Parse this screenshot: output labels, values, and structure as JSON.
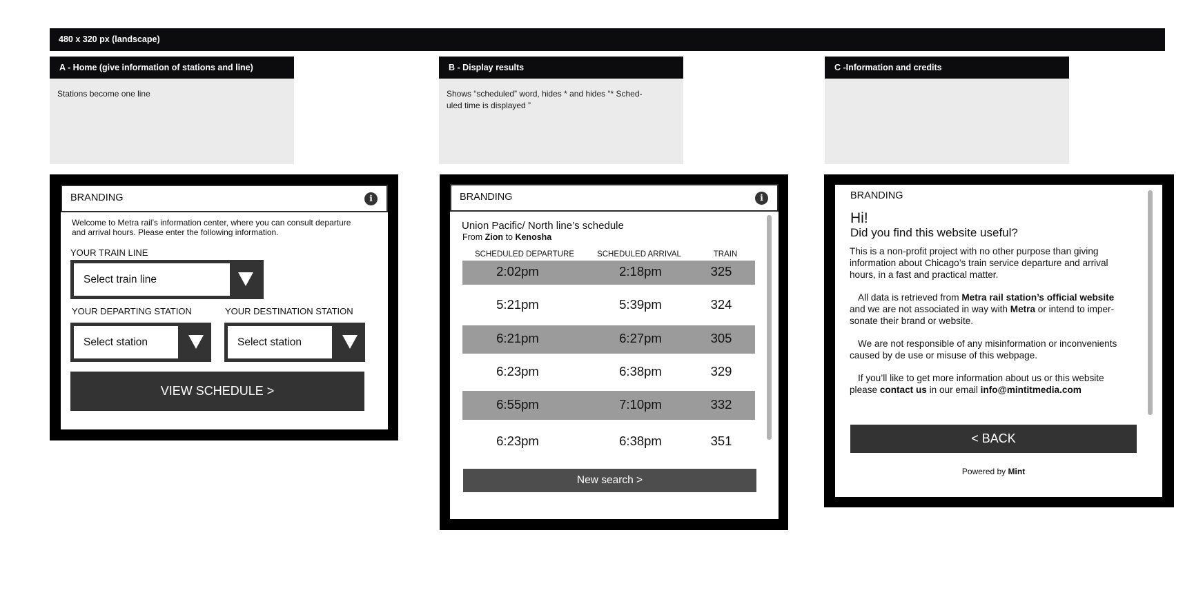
{
  "top_banner": "480 x 320 px (landscape)",
  "notes": [
    {
      "title": "A - Home (give information of stations and line)",
      "body": "Stations become one line"
    },
    {
      "title": "B - Display results",
      "body_line1": "Shows “scheduled” word, hides * and hides “* Sched-",
      "body_line2": "uled time is displayed ”"
    },
    {
      "title": "C -Information and credits",
      "body": ""
    }
  ],
  "screen_a": {
    "branding": "BRANDING",
    "info_icon": "info-icon",
    "welcome_line1": "Welcome to Metra rail’s information center, where you can consult departure",
    "welcome_line2": "and arrival hours. Please enter the following information.",
    "train_line_label": "YOUR TRAIN  LINE",
    "train_line_select": "Select train line",
    "departing_label": "YOUR  DEPARTING STATION",
    "destination_label": "YOUR DESTINATION STATION",
    "departing_select": "Select station",
    "destination_select": "Select station",
    "view_schedule_button": "VIEW SCHEDULE   >"
  },
  "screen_b": {
    "branding": "BRANDING",
    "info_icon": "info-icon",
    "title": "Union Pacific/ North line’s schedule",
    "from_label": "From",
    "from_station": "Zion",
    "to_label": "to",
    "to_station": "Kenosha",
    "columns": [
      "SCHEDULED DEPARTURE",
      "SCHEDULED ARRIVAL",
      "TRAIN"
    ],
    "rows": [
      {
        "departure": "2:02pm",
        "arrival": "2:18pm",
        "train": "325",
        "shaded": true
      },
      {
        "departure": "5:21pm",
        "arrival": "5:39pm",
        "train": "324",
        "shaded": false
      },
      {
        "departure": "6:21pm",
        "arrival": "6:27pm",
        "train": "305",
        "shaded": true
      },
      {
        "departure": "6:23pm",
        "arrival": "6:38pm",
        "train": "329",
        "shaded": false
      },
      {
        "departure": "6:55pm",
        "arrival": "7:10pm",
        "train": "332",
        "shaded": true
      },
      {
        "departure": "6:23pm",
        "arrival": "6:38pm",
        "train": "351",
        "shaded": false
      }
    ],
    "new_search_button": "New search   >"
  },
  "screen_c": {
    "branding": "BRANDING",
    "hi": "Hi!",
    "question": "Did you find this website useful?",
    "para1_line1": "This is a non-profit project with no other purpose than giving",
    "para1_line2": "information about Chicago’s train service departure and arrival",
    "para1_line3": "hours, in a fast and practical matter.",
    "para2_a": "All data is retrieved from",
    "para2_b": "Metra rail station’s official website",
    "para2_c": "and we are not associated in way with",
    "para2_d": "Metra",
    "para2_e": "or intend to imper-",
    "para2_f": "sonate their brand or website.",
    "para3_line1": "We are not responsible of any misinformation or inconvenients",
    "para3_line2": "caused by de use or misuse of this webpage.",
    "para4_line1": "If you’ll like to get more information about us or this website",
    "para4_a": "please",
    "para4_b": "contact us",
    "para4_c": "in our email",
    "para4_d": "info@mintitmedia.com",
    "back_button": "<    BACK",
    "powered_by": "Powered by",
    "powered_brand": "Mint"
  }
}
